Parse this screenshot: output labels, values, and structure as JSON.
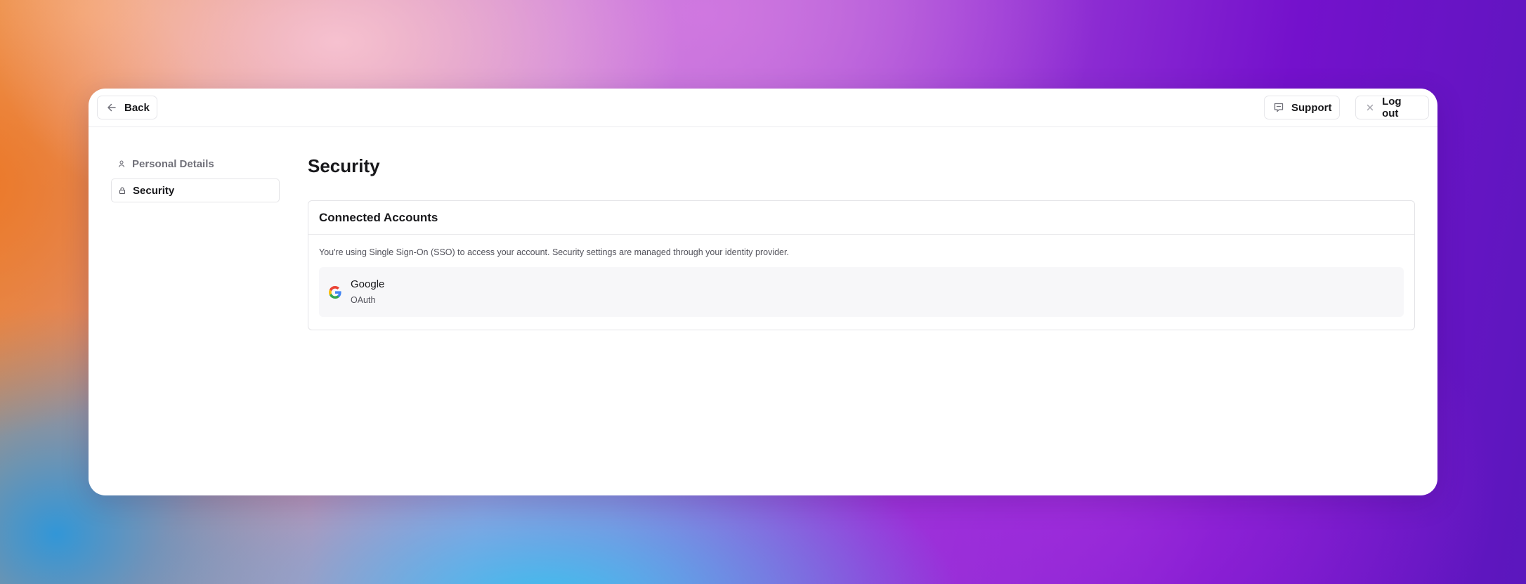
{
  "topbar": {
    "back_label": "Back",
    "support_label": "Support",
    "logout_label": "Log out"
  },
  "sidebar": {
    "items": [
      {
        "label": "Personal Details",
        "icon": "user-icon",
        "active": false
      },
      {
        "label": "Security",
        "icon": "lock-icon",
        "active": true
      }
    ]
  },
  "main": {
    "title": "Security",
    "card": {
      "title": "Connected Accounts",
      "description": "You're using Single Sign-On (SSO) to access your account. Security settings are managed through your identity provider.",
      "accounts": [
        {
          "name": "Google",
          "type": "OAuth",
          "icon": "google-icon"
        }
      ]
    }
  },
  "colors": {
    "text_primary": "#18181b",
    "text_muted": "#71717a",
    "border": "#e4e4e7",
    "account_bg": "#f7f7f9"
  }
}
